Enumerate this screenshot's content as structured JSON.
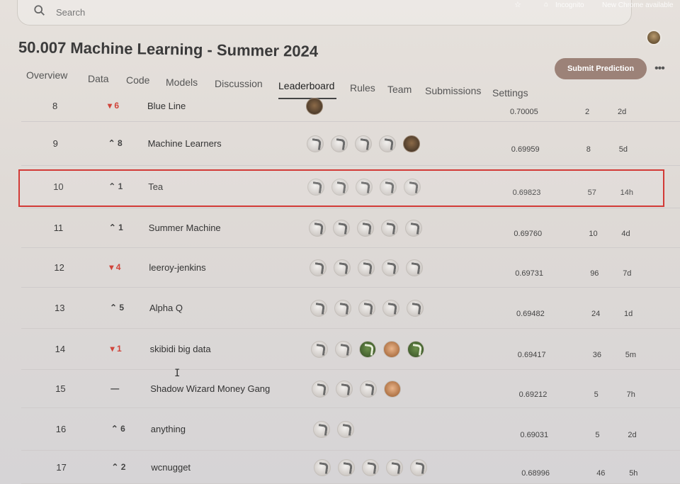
{
  "search": {
    "placeholder": "Search"
  },
  "browser": {
    "incognito_label": "Incognito",
    "update_label": "New Chrome available"
  },
  "competition": {
    "title": "50.007 Machine Learning - Summer 2024"
  },
  "actions": {
    "submit_label": "Submit Prediction",
    "more_label": "•••"
  },
  "tabs": [
    {
      "label": "Overview"
    },
    {
      "label": "Data"
    },
    {
      "label": "Code"
    },
    {
      "label": "Models"
    },
    {
      "label": "Discussion"
    },
    {
      "label": "Leaderboard",
      "active": true
    },
    {
      "label": "Rules"
    },
    {
      "label": "Team"
    },
    {
      "label": "Submissions"
    },
    {
      "label": "Settings"
    }
  ],
  "leaderboard": {
    "rows": [
      {
        "rank": "8",
        "delta": "▾ 6",
        "direction": "down",
        "team": "Blue Line",
        "avatars": [
          "photo"
        ],
        "score": "0.70005",
        "entries": "2",
        "last": "2d"
      },
      {
        "rank": "9",
        "delta": "⌃ 8",
        "direction": "up",
        "team": "Machine Learners",
        "avatars": [
          "default",
          "default",
          "default",
          "default",
          "photo"
        ],
        "score": "0.69959",
        "entries": "8",
        "last": "5d"
      },
      {
        "rank": "10",
        "delta": "⌃ 1",
        "direction": "up",
        "team": "Tea",
        "avatars": [
          "default",
          "default",
          "default",
          "default",
          "default"
        ],
        "score": "0.69823",
        "entries": "57",
        "last": "14h",
        "highlighted": true
      },
      {
        "rank": "11",
        "delta": "⌃ 1",
        "direction": "up",
        "team": "Summer Machine",
        "avatars": [
          "default",
          "default",
          "default",
          "default",
          "default"
        ],
        "score": "0.69760",
        "entries": "10",
        "last": "4d"
      },
      {
        "rank": "12",
        "delta": "▾ 4",
        "direction": "down",
        "team": "leeroy-jenkins",
        "avatars": [
          "default",
          "default",
          "default",
          "default",
          "default"
        ],
        "score": "0.69731",
        "entries": "96",
        "last": "7d"
      },
      {
        "rank": "13",
        "delta": "⌃ 5",
        "direction": "up",
        "team": "Alpha Q",
        "avatars": [
          "default",
          "default",
          "default",
          "default",
          "default"
        ],
        "score": "0.69482",
        "entries": "24",
        "last": "1d"
      },
      {
        "rank": "14",
        "delta": "▾ 1",
        "direction": "down",
        "team": "skibidi big data",
        "avatars": [
          "default",
          "default",
          "green",
          "orange",
          "green"
        ],
        "score": "0.69417",
        "entries": "36",
        "last": "5m"
      },
      {
        "rank": "15",
        "delta": "—",
        "direction": "same",
        "team": "Shadow Wizard Money Gang",
        "avatars": [
          "default",
          "default",
          "default",
          "orange"
        ],
        "score": "0.69212",
        "entries": "5",
        "last": "7h"
      },
      {
        "rank": "16",
        "delta": "⌃ 6",
        "direction": "up",
        "team": "anything",
        "avatars": [
          "default",
          "default"
        ],
        "score": "0.69031",
        "entries": "5",
        "last": "2d"
      },
      {
        "rank": "17",
        "delta": "⌃ 2",
        "direction": "up",
        "team": "wcnugget",
        "avatars": [
          "default",
          "default",
          "default",
          "default",
          "default"
        ],
        "score": "0.68996",
        "entries": "46",
        "last": "5h"
      }
    ]
  }
}
